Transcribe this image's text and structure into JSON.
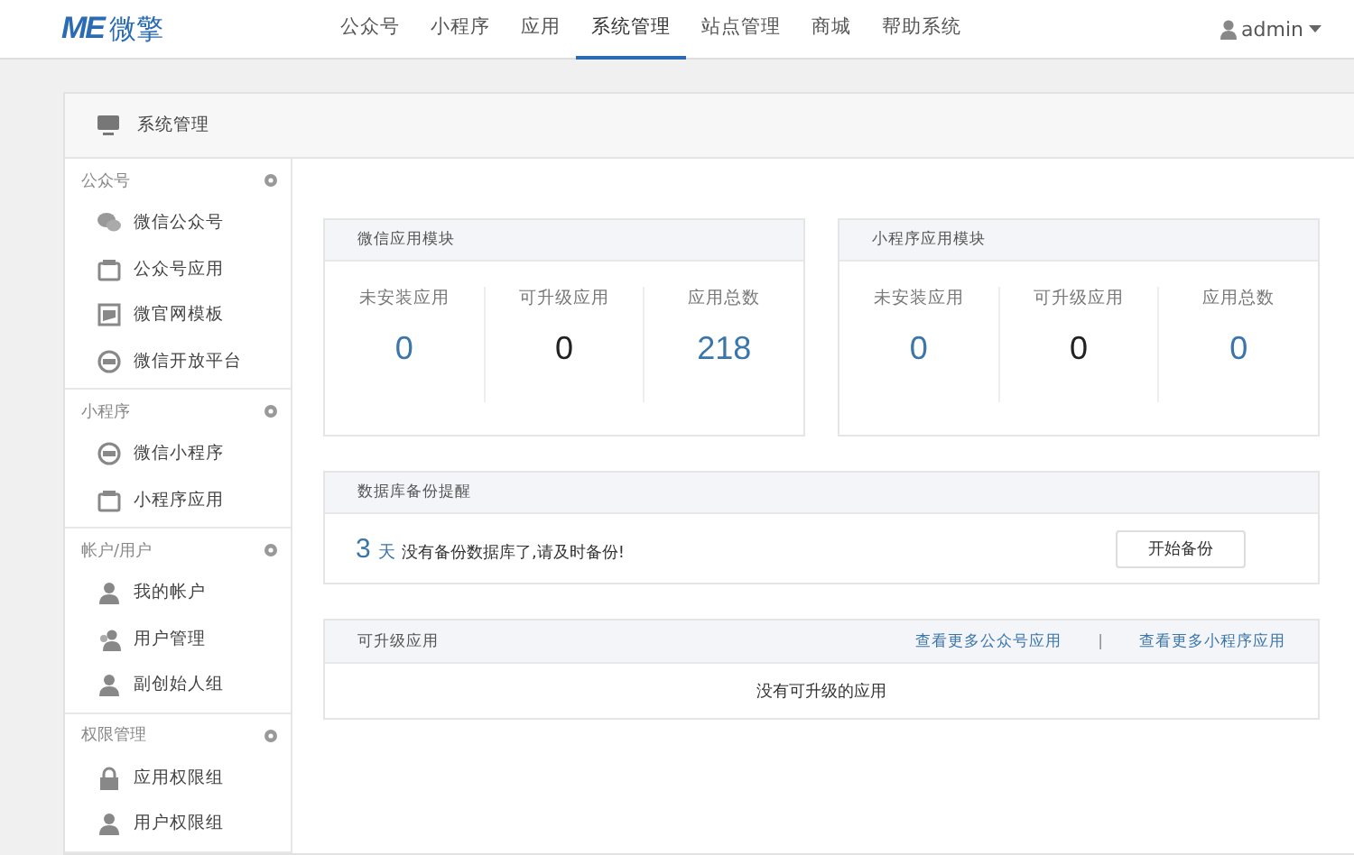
{
  "brand": {
    "mark": "ME",
    "name": "微擎"
  },
  "nav": [
    {
      "label": "公众号",
      "selected": false
    },
    {
      "label": "小程序",
      "selected": false
    },
    {
      "label": "应用",
      "selected": false
    },
    {
      "label": "系统管理",
      "selected": true
    },
    {
      "label": "站点管理",
      "selected": false
    },
    {
      "label": "商城",
      "selected": false
    },
    {
      "label": "帮助系统",
      "selected": false
    }
  ],
  "user": {
    "name": "admin"
  },
  "panel": {
    "title": "系统管理"
  },
  "sidebar": [
    {
      "title": "公众号",
      "items": [
        "微信公众号",
        "公众号应用",
        "微官网模板",
        "微信开放平台"
      ]
    },
    {
      "title": "小程序",
      "items": [
        "微信小程序",
        "小程序应用"
      ]
    },
    {
      "title": "帐户/用户",
      "items": [
        "我的帐户",
        "用户管理",
        "副创始人组"
      ]
    },
    {
      "title": "权限管理",
      "items": [
        "应用权限组",
        "用户权限组"
      ]
    }
  ],
  "modules": [
    {
      "title": "微信应用模块",
      "stats": [
        {
          "label": "未安装应用",
          "value": "0",
          "highlight": true
        },
        {
          "label": "可升级应用",
          "value": "0",
          "highlight": false
        },
        {
          "label": "应用总数",
          "value": "218",
          "highlight": true
        }
      ]
    },
    {
      "title": "小程序应用模块",
      "stats": [
        {
          "label": "未安装应用",
          "value": "0",
          "highlight": true
        },
        {
          "label": "可升级应用",
          "value": "0",
          "highlight": false
        },
        {
          "label": "应用总数",
          "value": "0",
          "highlight": true
        }
      ]
    }
  ],
  "backup": {
    "title": "数据库备份提醒",
    "days": "3",
    "unit": "天",
    "message": "没有备份数据库了,请及时备份!",
    "button": "开始备份"
  },
  "upgrades": {
    "title": "可升级应用",
    "links": [
      "查看更多公众号应用",
      "查看更多小程序应用"
    ],
    "separator": "|",
    "empty": "没有可升级的应用"
  }
}
